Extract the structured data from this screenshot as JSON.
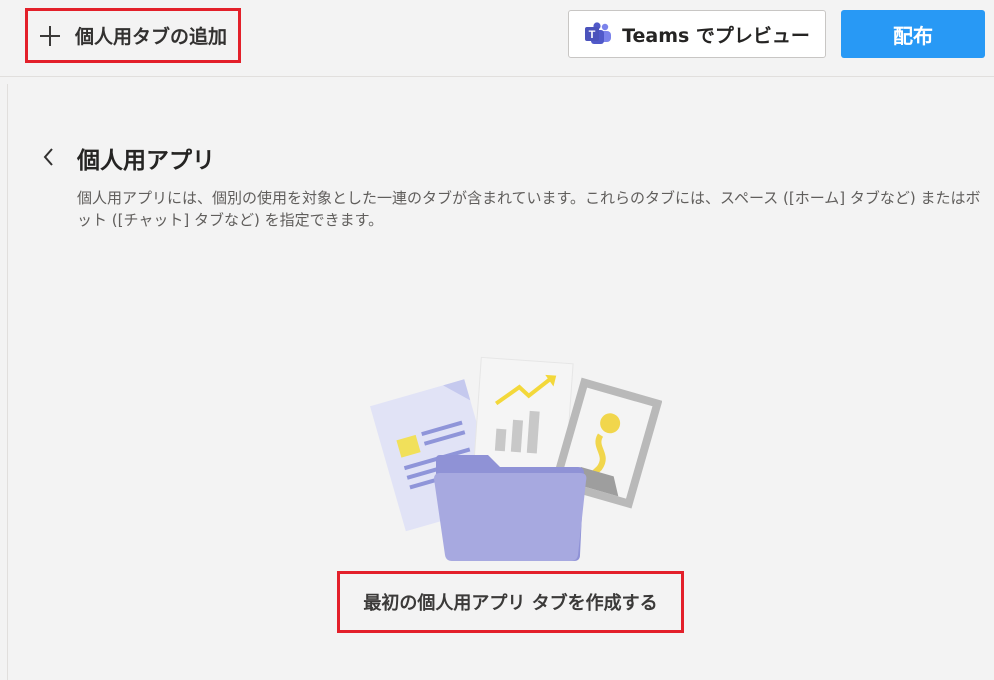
{
  "header": {
    "add_tab_label": "個人用タブの追加",
    "preview_label": "Teams でプレビュー",
    "publish_label": "配布",
    "teams_icon_letter": "T"
  },
  "main": {
    "title": "個人用アプリ",
    "description": "個人用アプリには、個別の使用を対象とした一連のタブが含まれています。これらのタブには、スペース ([ホーム] タブなど) またはボット ([チャット] タブなど) を指定できます。",
    "create_tab_label": "最初の個人用アプリ タブを作成する"
  },
  "colors": {
    "accent": "#2899f5",
    "highlight_border": "#e3202a",
    "teams_purple": "#5059c9"
  },
  "icons": {
    "add": "plus-icon",
    "back": "chevron-left-icon",
    "teams": "teams-logo-icon",
    "empty_state": "folder-documents-illustration"
  }
}
